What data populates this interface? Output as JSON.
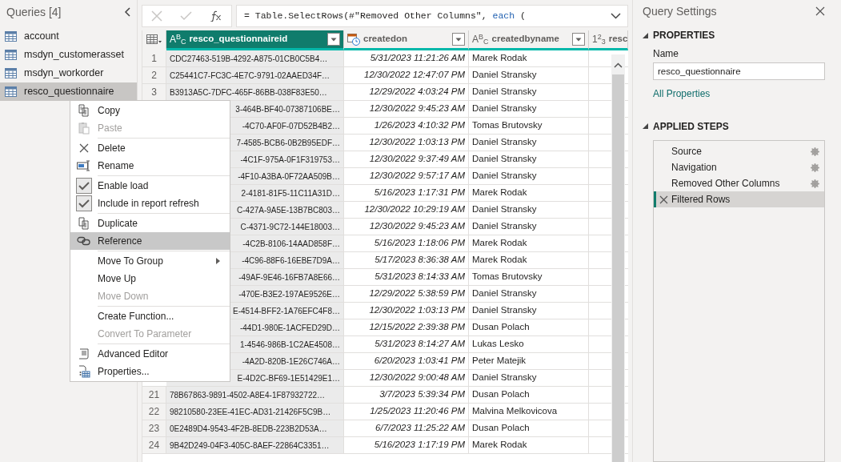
{
  "queries": {
    "title": "Queries [4]",
    "items": [
      {
        "label": "account",
        "selected": false
      },
      {
        "label": "msdyn_customerasset",
        "selected": false
      },
      {
        "label": "msdyn_workorder",
        "selected": false
      },
      {
        "label": "resco_questionnaire",
        "selected": true
      }
    ]
  },
  "formula": [
    {
      "text": "= Table.SelectRows(#\"Removed Other Columns\", ",
      "kind": "plain"
    },
    {
      "text": "each",
      "kind": "keyword"
    },
    {
      "text": " (",
      "kind": "plain"
    }
  ],
  "table": {
    "columns": [
      {
        "name": "resco_questionnaireid",
        "kind": "text",
        "type_glyph": "A$^{B}$$_{C}$",
        "selected": true,
        "filter": true
      },
      {
        "name": "createdon",
        "kind": "datetime",
        "selected": false,
        "filter": true
      },
      {
        "name": "createdbyname",
        "kind": "text",
        "type_glyph": "A$^{B}$$_{C}$",
        "selected": false,
        "filter": true
      },
      {
        "name": "resc",
        "kind": "number",
        "type_glyph": "1$^{2}$$_{3}$",
        "selected": false,
        "filter": false
      }
    ],
    "rows": [
      {
        "number": "1",
        "covered": false,
        "cells": [
          "CDC27463-519B-4292-A875-01CB0C5B4…",
          "5/31/2023 11:21:26 AM",
          "Marek Rodak"
        ]
      },
      {
        "number": "2",
        "covered": false,
        "cells": [
          "C25441C7-FC3C-4E7C-9791-02AAED34F…",
          "12/30/2022 12:47:07 PM",
          "Daniel Stransky"
        ]
      },
      {
        "number": "3",
        "covered": false,
        "cells": [
          "B3913A5C-7DFC-465F-86BB-038F83E50…",
          "12/29/2022 4:03:24 PM",
          "Daniel Stransky"
        ]
      },
      {
        "covered": true,
        "cells": [
          "3-464B-BF40-07387106BE…",
          "12/30/2022 9:45:23 AM",
          "Daniel Stransky"
        ]
      },
      {
        "covered": true,
        "cells": [
          "-4C70-AF0F-07D52B4B2…",
          "1/26/2023 4:10:32 PM",
          "Tomas Brutovsky"
        ]
      },
      {
        "covered": true,
        "cells": [
          "7-4585-BCB6-0B2B95EDF…",
          "12/30/2022 1:03:13 PM",
          "Daniel Stransky"
        ]
      },
      {
        "covered": true,
        "cells": [
          "-4C1F-975A-0F1F319753…",
          "12/30/2022 9:37:49 AM",
          "Daniel Stransky"
        ]
      },
      {
        "covered": true,
        "cells": [
          "-4F10-A3BA-0F72AA509B…",
          "12/30/2022 9:57:17 AM",
          "Daniel Stransky"
        ]
      },
      {
        "covered": true,
        "cells": [
          "2-4181-81F5-11C11A31D…",
          "5/16/2023 1:17:31 PM",
          "Marek Rodak"
        ]
      },
      {
        "covered": true,
        "cells": [
          "C-427A-9A5E-13B7BC803…",
          "12/30/2022 10:29:19 AM",
          "Daniel Stransky"
        ]
      },
      {
        "covered": true,
        "cells": [
          "C-4371-9C72-144E18003…",
          "12/30/2022 9:45:23 AM",
          "Daniel Stransky"
        ]
      },
      {
        "covered": true,
        "cells": [
          "-4C2B-8106-14AAD858F…",
          "5/16/2023 1:18:06 PM",
          "Marek Rodak"
        ]
      },
      {
        "covered": true,
        "cells": [
          "-4C96-88F6-16EBE7D9A…",
          "5/17/2023 8:36:38 AM",
          "Marek Rodak"
        ]
      },
      {
        "covered": true,
        "cells": [
          "-49AF-9E46-16FB7A8E66…",
          "5/31/2023 8:14:33 AM",
          "Tomas Brutovsky"
        ]
      },
      {
        "covered": true,
        "cells": [
          "-470E-B3E2-197AE9526E…",
          "12/29/2022 5:38:59 PM",
          "Daniel Stransky"
        ]
      },
      {
        "covered": true,
        "cells": [
          "E-4514-BFF2-1A76EFC4F8…",
          "12/30/2022 1:03:13 PM",
          "Daniel Stransky"
        ]
      },
      {
        "covered": true,
        "cells": [
          "-44D1-980E-1ACFED29D…",
          "12/15/2022 2:39:38 PM",
          "Dusan Polach"
        ]
      },
      {
        "covered": true,
        "cells": [
          "1-4546-986B-1C2AE4508…",
          "5/31/2023 8:14:27 AM",
          "Lukas Lesko"
        ]
      },
      {
        "covered": true,
        "cells": [
          "-4A2D-820B-1E26C746A…",
          "6/20/2023 1:03:41 PM",
          "Peter Matejik"
        ]
      },
      {
        "covered": true,
        "cells": [
          "E-4D2C-BF69-1E51429E1…",
          "12/30/2022 9:00:48 AM",
          "Daniel Stransky"
        ]
      },
      {
        "number": "21",
        "covered": false,
        "cells": [
          "78B67863-9891-4502-A8E4-1F87932722…",
          "3/7/2023 5:39:34 PM",
          "Dusan Polach"
        ]
      },
      {
        "number": "22",
        "covered": false,
        "cells": [
          "98210580-23EE-41EC-AD31-21426F5C9B…",
          "1/25/2023 11:20:46 PM",
          "Malvina Melkovicova"
        ]
      },
      {
        "number": "23",
        "covered": false,
        "cells": [
          "0E2489D4-9543-4F2B-8EDB-223B2D53A…",
          "6/7/2023 11:25:22 AM",
          "Dusan Polach"
        ]
      },
      {
        "number": "24",
        "covered": false,
        "cells": [
          "9B42D249-04F3-405C-8AEF-22864C3351…",
          "5/16/2023 1:17:19 PM",
          "Marek Rodak"
        ]
      }
    ]
  },
  "context_menu": {
    "groups": [
      [
        {
          "label": "Copy",
          "kind": "command",
          "disabled": false,
          "highlighted": false
        },
        {
          "label": "Paste",
          "kind": "command",
          "disabled": true,
          "highlighted": false
        }
      ],
      [
        {
          "label": "Delete",
          "kind": "command",
          "disabled": false,
          "highlighted": false
        },
        {
          "label": "Rename",
          "kind": "command",
          "disabled": false,
          "highlighted": false
        }
      ],
      [
        {
          "label": "Enable load",
          "kind": "check",
          "checked": true,
          "disabled": false,
          "highlighted": false
        },
        {
          "label": "Include in report refresh",
          "kind": "check",
          "checked": true,
          "disabled": false,
          "highlighted": false
        }
      ],
      [
        {
          "label": "Duplicate",
          "kind": "command",
          "disabled": false,
          "highlighted": false
        },
        {
          "label": "Reference",
          "kind": "command",
          "disabled": false,
          "highlighted": true
        }
      ],
      [
        {
          "label": "Move To Group",
          "kind": "submenu",
          "disabled": false,
          "highlighted": false
        },
        {
          "label": "Move Up",
          "kind": "command",
          "disabled": false,
          "highlighted": false
        },
        {
          "label": "Move Down",
          "kind": "command",
          "disabled": true,
          "highlighted": false
        }
      ],
      [
        {
          "label": "Create Function...",
          "kind": "command",
          "disabled": false,
          "highlighted": false
        },
        {
          "label": "Convert To Parameter",
          "kind": "command",
          "disabled": true,
          "highlighted": false
        }
      ],
      [
        {
          "label": "Advanced Editor",
          "kind": "command",
          "disabled": false,
          "highlighted": false
        },
        {
          "label": "Properties...",
          "kind": "command",
          "disabled": false,
          "highlighted": false
        }
      ]
    ]
  },
  "settings": {
    "title": "Query Settings",
    "properties": {
      "heading": "PROPERTIES",
      "expanded": true,
      "name_label": "Name",
      "name_value": "resco_questionnaire",
      "link": "All Properties"
    },
    "steps": {
      "heading": "APPLIED STEPS",
      "expanded": true,
      "items": [
        {
          "label": "Source",
          "has_settings": true,
          "selected": false
        },
        {
          "label": "Navigation",
          "has_settings": true,
          "selected": false
        },
        {
          "label": "Removed Other Columns",
          "has_settings": true,
          "selected": false
        },
        {
          "label": "Filtered Rows",
          "has_settings": false,
          "selected": true
        }
      ]
    }
  }
}
